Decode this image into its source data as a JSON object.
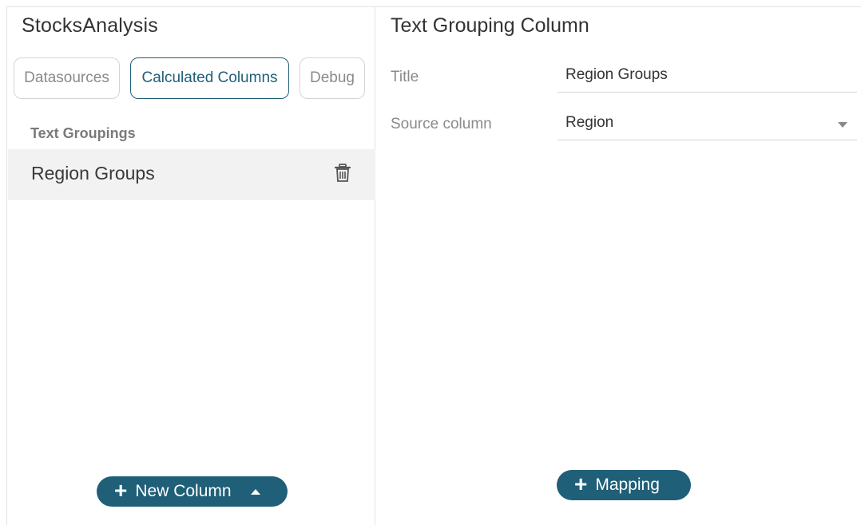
{
  "left_panel": {
    "app_title": "StocksAnalysis",
    "tabs": [
      {
        "label": "Datasources",
        "active": false
      },
      {
        "label": "Calculated Columns",
        "active": true
      },
      {
        "label": "Debug",
        "active": false
      }
    ],
    "section_label": "Text Groupings",
    "items": [
      {
        "label": "Region Groups",
        "icon": "trash-icon"
      }
    ],
    "new_column_button": {
      "label": "New Column",
      "icon": "plus-icon",
      "caret": "caret-up-icon"
    }
  },
  "right_panel": {
    "title": "Text Grouping Column",
    "fields": {
      "title": {
        "label": "Title",
        "value": "Region Groups"
      },
      "source_column": {
        "label": "Source column",
        "value": "Region",
        "icon": "chevron-down-icon"
      }
    },
    "mapping_button": {
      "label": "Mapping",
      "icon": "plus-icon"
    }
  },
  "colors": {
    "accent": "#1f5f78",
    "selected_row": "#f2f2f2",
    "muted_text": "#8a8a8a",
    "border": "#d4d4d4"
  }
}
